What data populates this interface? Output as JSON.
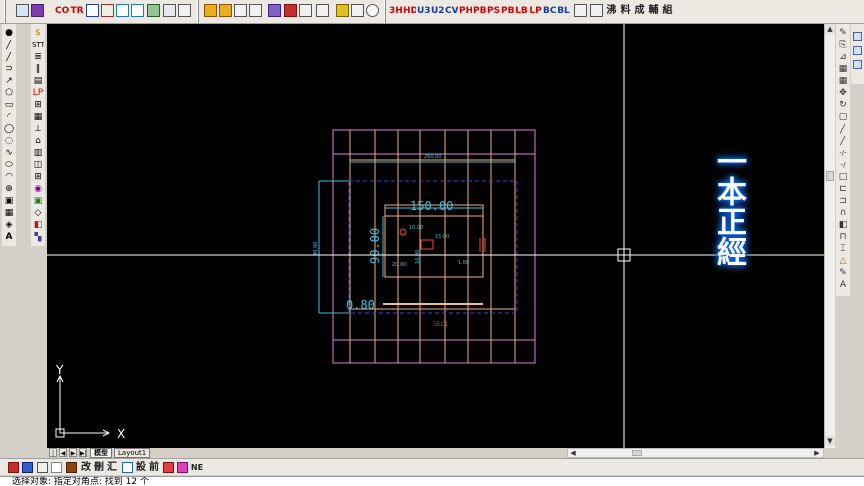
{
  "toolbar_top": {
    "buttons_left": [
      "CO",
      "TR"
    ],
    "buttons_text": [
      "3H",
      "HD",
      "U3",
      "U2",
      "CV",
      "PH",
      "PB",
      "PS",
      "PB",
      "LB",
      "LP",
      "BC",
      "BL"
    ],
    "buttons_cjk": [
      "沸",
      "料",
      "成",
      "輔",
      "組"
    ],
    "icons": [
      "new-file-icon",
      "open-icon",
      "save-icon",
      "print-icon",
      "cut-icon",
      "copy-icon",
      "paste-icon",
      "match-icon",
      "undo-icon",
      "redo-icon",
      "pan-icon",
      "zoom-icon",
      "layer-icon",
      "properties-icon"
    ]
  },
  "toolbar_left_draw": {
    "items": [
      "•",
      "/",
      "/",
      "⊃",
      "↗",
      "⬠",
      "▭",
      "◠",
      "◯",
      "◌",
      "◎",
      "~",
      "○",
      "◐",
      "⊕",
      "▣",
      "▦",
      "◈",
      "A"
    ]
  },
  "toolbar_left_custom": {
    "items": [
      "S",
      "STT",
      "≣",
      "||",
      "▤",
      "Ψ",
      "⊞",
      "▦",
      "L",
      "⌂",
      "▥",
      "◫",
      "⊞",
      "◉",
      "▣",
      "◇",
      "◧",
      "▚",
      "◉"
    ]
  },
  "toolbar_right_modify": {
    "items": [
      "✎",
      "⎘",
      "⊿",
      "▦",
      "✥",
      "↻",
      "□",
      "/",
      "/",
      "-/-",
      "-/",
      "□",
      "⊏",
      "⊐",
      "∩",
      "+",
      "⌐",
      "△",
      "⊓",
      "⊕",
      "✎",
      "A/"
    ]
  },
  "canvas": {
    "dim_top_small": "260.00",
    "dim_width": "150.00",
    "dim_height": "90.00",
    "dim_left_small": "90.00",
    "dim_thickness": "0.80",
    "dim_r1": "10.00",
    "dim_r2": "15.00",
    "dim_r3": "20.00",
    "dim_r4": "1.00",
    "dim_h_small": "10.00",
    "section_label": "SEC1",
    "watermark": "一本正經",
    "ucs_x": "X",
    "ucs_y": "Y"
  },
  "tabs": {
    "model": "模型",
    "layout1": "Layout1"
  },
  "toolbar_bottom": {
    "items_cjk": [
      "改",
      "刪",
      "汇",
      "設",
      "前"
    ],
    "item_ne": "NE"
  },
  "command_line": {
    "text": "选择对象: 指定对角点: 找到 12 个"
  },
  "colors": {
    "canvas_bg": "#000000",
    "crosshair": "#ffffff",
    "outer_grid": "#e080e0",
    "inner_grid": "#f0b080",
    "dimension": "#40c0e0",
    "dashed_box": "#4040e0",
    "red_marks": "#ff4040",
    "watermark_fill": "#ffffff",
    "watermark_glow": "#0060ff"
  }
}
